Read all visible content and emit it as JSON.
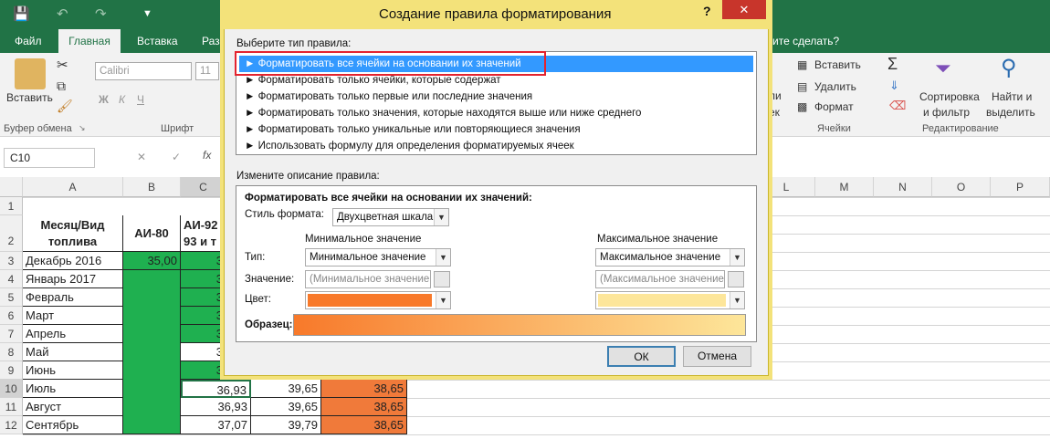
{
  "ribbon": {
    "tabs": [
      "Файл",
      "Главная",
      "Вставка",
      "Разм"
    ],
    "tell_me": "ите сделать?",
    "paste_label": "Вставить",
    "clipboard_group": "Буфер обмена",
    "font_group": "Шрифт",
    "font_name": "Calibri",
    "font_size": "11",
    "bold": "Ж",
    "italic": "К",
    "underline": "Ч",
    "partial_1": "ли",
    "partial_2": "ек",
    "cells_insert": "Вставить",
    "cells_delete": "Удалить",
    "cells_format": "Формат",
    "cells_group": "Ячейки",
    "sort_filter": "Сортировка",
    "sort_filter_2": "и фильтр",
    "find_select": "Найти и",
    "find_select_2": "выделить",
    "editing_group": "Редактирование"
  },
  "formula_bar": {
    "name_box": "C10",
    "fx": "fx"
  },
  "grid": {
    "columns": [
      "A",
      "B",
      "C",
      "L",
      "M",
      "N",
      "O",
      "P"
    ],
    "rows": [
      "1",
      "2",
      "3",
      "4",
      "5",
      "6",
      "7",
      "8",
      "9",
      "10",
      "11",
      "12"
    ],
    "header_month": "Месяц/Вид",
    "header_fuel": "топлива",
    "header_ai80": "АИ-80",
    "header_ai92": "АИ-92",
    "header_ai92b": "93 и т",
    "months": [
      "Декабрь 2016",
      "Январь 2017",
      "Февраль",
      "Март",
      "Апрель",
      "Май",
      "Июнь",
      "Июль",
      "Август",
      "Сентябрь"
    ],
    "b3": "35,00",
    "c_values": [
      "3",
      "3",
      "3",
      "3",
      "3",
      "3",
      "3"
    ],
    "row10": [
      "36,93",
      "39,65",
      "38,65"
    ],
    "row11": [
      "36,93",
      "39,65",
      "38,65"
    ],
    "row12": [
      "37,07",
      "39,79",
      "38,65"
    ]
  },
  "dialog": {
    "title": "Создание правила форматирования",
    "help": "?",
    "close": "✕",
    "select_rule_label": "Выберите тип правила:",
    "rules": [
      "Форматировать все ячейки на основании их значений",
      "Форматировать только ячейки, которые содержат",
      "Форматировать только первые или последние значения",
      "Форматировать только значения, которые находятся выше или ниже среднего",
      "Форматировать только уникальные или повторяющиеся значения",
      "Использовать формулу для определения форматируемых ячеек"
    ],
    "edit_desc_label": "Измените описание правила:",
    "desc_title": "Форматировать все ячейки на основании их значений:",
    "format_style_label": "Стиль формата:",
    "format_style_value": "Двухцветная шкала",
    "min_header": "Минимальное значение",
    "max_header": "Максимальное значение",
    "type_label": "Тип:",
    "value_label": "Значение:",
    "color_label": "Цвет:",
    "min_type": "Минимальное значение",
    "max_type": "Максимальное значение",
    "min_value": "(Минимальное значение",
    "max_value": "(Максимальное значение",
    "preview_label": "Образец:",
    "ok": "ОК",
    "cancel": "Отмена",
    "min_color": "#f8792a",
    "max_color": "#fde69a"
  }
}
